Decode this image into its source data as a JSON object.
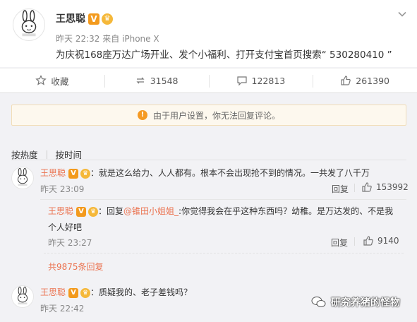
{
  "post": {
    "author": "王思聪",
    "verified_mark": "V",
    "meta": "昨天 22:32 来自 iPhone X",
    "text": "为庆祝168座万达广场开业、发个小福利、打开支付宝首页搜索“ 530280410 ”"
  },
  "actions": {
    "favorite": "收藏",
    "repost": "31548",
    "comment": "122813",
    "like": "261390"
  },
  "notice": "由于用户设置，你无法回复评论。",
  "sort": {
    "hot": "按热度",
    "time": "按时间"
  },
  "comments": [
    {
      "author": "王思聪",
      "text": "：就是这么给力、人人都有。根本不会出现抢不到的情况。一共发了八千万",
      "time": "昨天 23:09",
      "reply_label": "回复",
      "likes": "153992",
      "sub": {
        "author": "王思聪",
        "text_prefix": "：回复",
        "mention": "@锥田小姐姐_",
        "text_line1": ":你觉得我会在乎这种东西吗？幼稚。是万达发的、不是我",
        "text_line2": "个人好吧",
        "time": "昨天 23:27",
        "reply_label": "回复",
        "likes": "9140"
      },
      "more": "共9875条回复"
    },
    {
      "author": "王思聪",
      "text": "：质疑我的、老子差钱吗？",
      "time": "昨天 22:42"
    }
  ],
  "watermark": "研究养猪的怪物",
  "colors": {
    "accent": "#eb7350",
    "verified": "#f39a1d",
    "notice_bg": "#fdf8ee"
  }
}
